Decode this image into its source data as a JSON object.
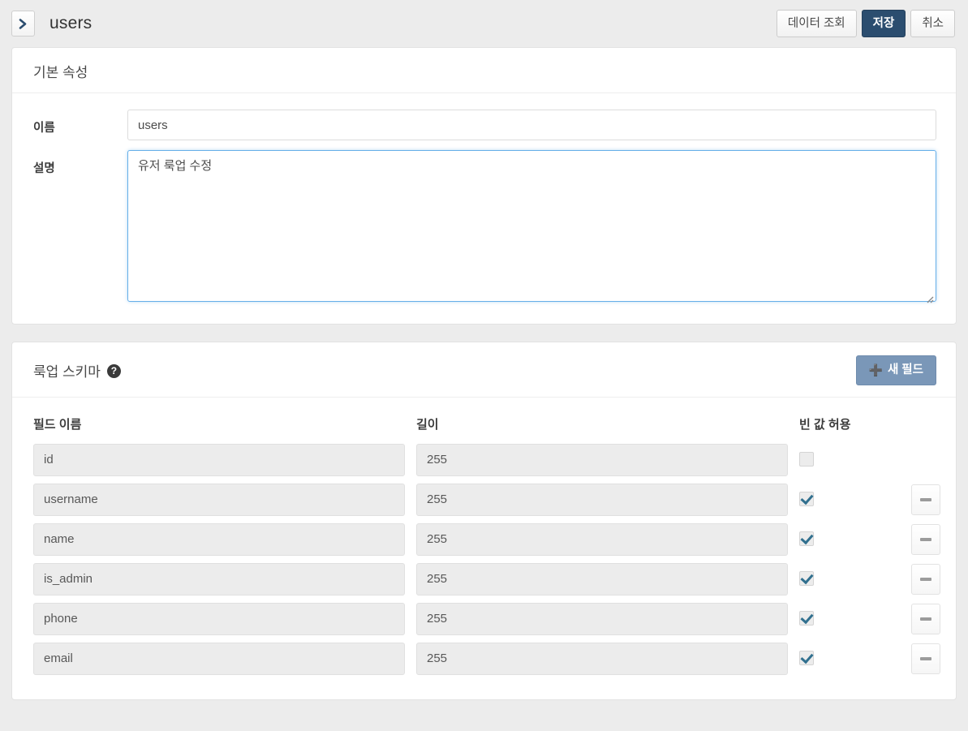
{
  "header": {
    "collapse_icon": "chevron-right-icon",
    "title": "users",
    "actions": {
      "view_data_label": "데이터 조회",
      "save_label": "저장",
      "cancel_label": "취소"
    }
  },
  "basic_properties": {
    "section_title": "기본 속성",
    "name_label": "이름",
    "name_value": "users",
    "description_label": "설명",
    "description_value": "유저 룩업 수정"
  },
  "lookup_schema": {
    "section_title": "룩업 스키마",
    "help_icon": "question-mark-icon",
    "new_field_label": "새 필드",
    "new_field_icon": "plus-icon",
    "columns": {
      "field_name": "필드 이름",
      "length": "길이",
      "allow_empty": "빈 값 허용"
    },
    "rows": [
      {
        "field_name": "id",
        "length": "255",
        "allow_empty": false,
        "allow_empty_disabled": true,
        "removable": false
      },
      {
        "field_name": "username",
        "length": "255",
        "allow_empty": true,
        "allow_empty_disabled": false,
        "removable": true
      },
      {
        "field_name": "name",
        "length": "255",
        "allow_empty": true,
        "allow_empty_disabled": false,
        "removable": true
      },
      {
        "field_name": "is_admin",
        "length": "255",
        "allow_empty": true,
        "allow_empty_disabled": false,
        "removable": true
      },
      {
        "field_name": "phone",
        "length": "255",
        "allow_empty": true,
        "allow_empty_disabled": false,
        "removable": true
      },
      {
        "field_name": "email",
        "length": "255",
        "allow_empty": true,
        "allow_empty_disabled": false,
        "removable": true
      }
    ]
  },
  "colors": {
    "page_background": "#ececec",
    "card_background": "#ffffff",
    "primary_button": "#2b4d6f",
    "new_field_button": "#7a97b8",
    "focus_border": "#66afe9",
    "checkmark": "#31708f"
  }
}
